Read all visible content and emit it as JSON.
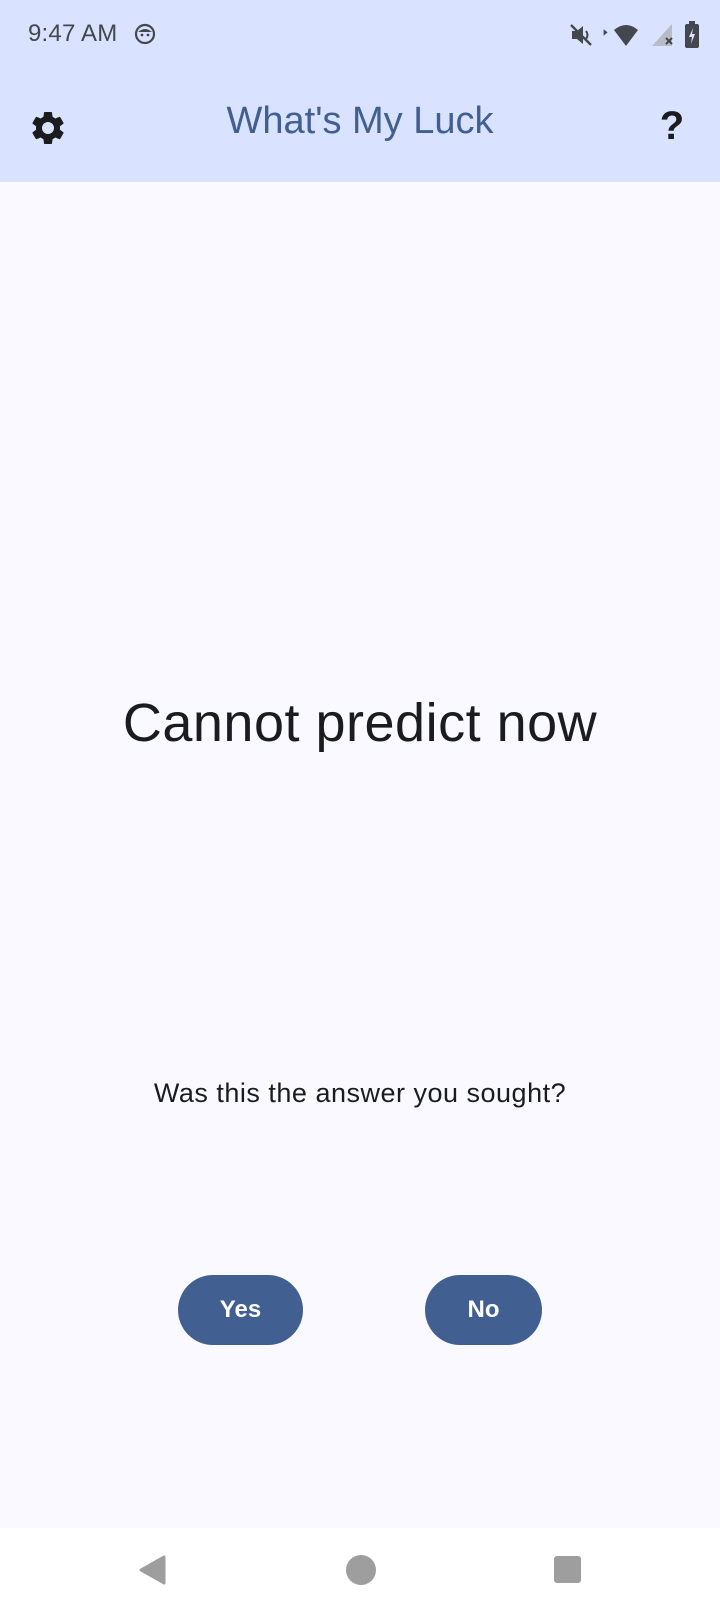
{
  "status_bar": {
    "time": "9:47 AM",
    "icons": [
      "face-notification-icon",
      "mute-icon",
      "wifi-icon",
      "cell-signal-icon",
      "battery-charging-icon"
    ]
  },
  "app_bar": {
    "title": "What's My Luck",
    "settings_icon": "gear-icon",
    "help_label": "?"
  },
  "main": {
    "prediction": "Cannot predict now",
    "question": "Was this the answer you sought?",
    "yes_label": "Yes",
    "no_label": "No"
  },
  "colors": {
    "header_bg": "#d9e2ff",
    "title_color": "#415f91",
    "button_bg": "#415f91",
    "page_bg": "#f9f9ff"
  },
  "nav_bar": {
    "icons": [
      "back-icon",
      "home-icon",
      "recents-icon"
    ]
  }
}
